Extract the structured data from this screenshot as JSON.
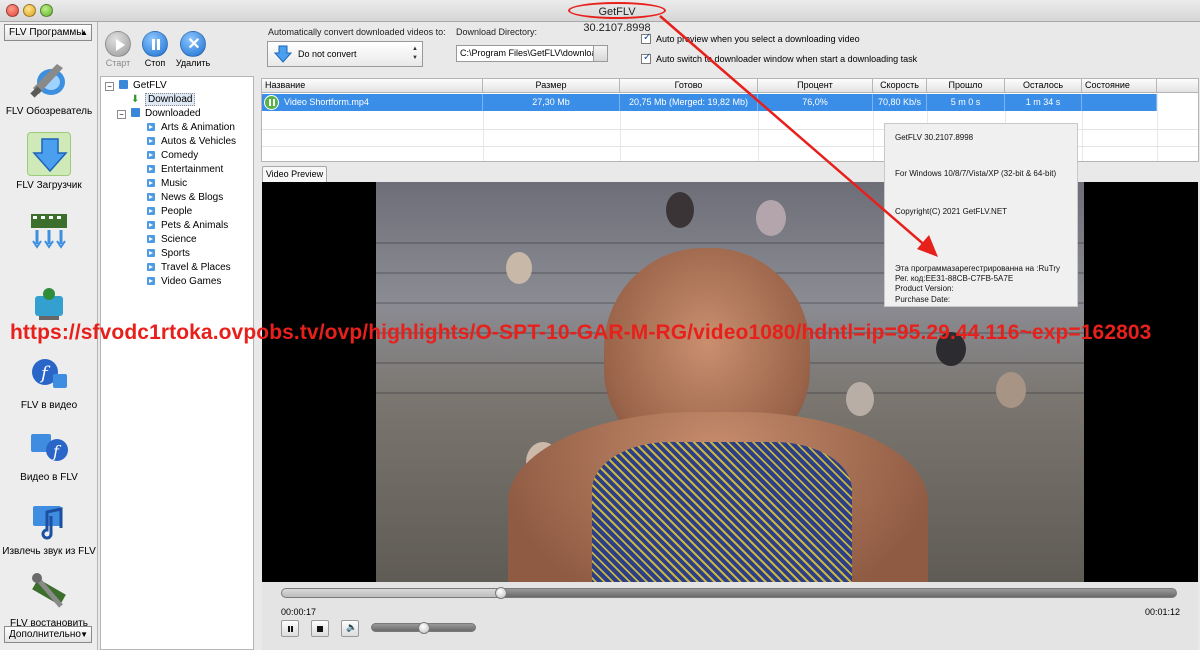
{
  "window": {
    "title": "GetFLV 30.2107.8998"
  },
  "sidebar": {
    "top_dropdown": "FLV Программы",
    "bottom_dropdown": "Дополнительно",
    "items": [
      {
        "label": "FLV Обозреватель",
        "icon": "browser-icon"
      },
      {
        "label": "FLV Загрузчик",
        "icon": "downloader-icon",
        "active": true
      },
      {
        "label": "",
        "icon": "film-convert-icon"
      },
      {
        "label": "",
        "icon": "video-download-icon"
      },
      {
        "label": "FLV в видео",
        "icon": "flv-to-video-icon"
      },
      {
        "label": "Видео в FLV",
        "icon": "video-to-flv-icon"
      },
      {
        "label": "Извлечь звук из FLV",
        "icon": "extract-audio-icon"
      },
      {
        "label": "FLV востановить",
        "icon": "repair-icon"
      }
    ]
  },
  "toolbar": {
    "start_label": "Старт",
    "stop_label": "Стоп",
    "delete_label": "Удалить",
    "convert_label": "Automatically convert downloaded videos to:",
    "convert_value": "Do not convert",
    "dir_label": "Download Directory:",
    "dir_value": "C:\\Program Files\\GetFLV\\download",
    "auto_preview_label": "Auto preview when you select a downloading video",
    "auto_switch_label": "Auto switch to downloader window when start a downloading task"
  },
  "tree": {
    "root": "GetFLV",
    "download": "Download",
    "downloaded": "Downloaded",
    "categories": [
      "Arts & Animation",
      "Autos & Vehicles",
      "Comedy",
      "Entertainment",
      "Music",
      "News & Blogs",
      "People",
      "Pets & Animals",
      "Science",
      "Sports",
      "Travel & Places",
      "Video Games"
    ]
  },
  "table": {
    "columns": [
      "Название",
      "Размер",
      "Готово",
      "Процент",
      "Скорость",
      "Прошло",
      "Осталось",
      "Состояние"
    ],
    "rows": [
      {
        "name": "Video Shortform.mp4",
        "size": "27,30 Mb",
        "done": "20,75 Mb  (Merged: 19,82 Mb)",
        "percent": "76,0%",
        "speed": "70,80 Kb/s",
        "elapsed": "5 m 0 s",
        "remaining": "1 m 34 s",
        "state": ""
      }
    ]
  },
  "preview": {
    "tab_label": "Video Preview",
    "time_current": "00:00:17",
    "time_total": "00:01:12",
    "seek_fraction": 0.245,
    "volume_fraction": 0.5
  },
  "about": {
    "line1": "GetFLV   30.2107.8998",
    "line2": "For Windows 10/8/7/Vista/XP (32-bit & 64-bit)",
    "line3": "Copyright(C) 2021 GetFLV.NET",
    "line4": "Эта программазарегестрированна на :RuTry",
    "line5": "Рег. код:EE31-88CB-C7FB-5A7E",
    "line6": "Product Version:",
    "line7": "Purchase Date:"
  },
  "overlay": {
    "url": "https://sfvodc1rtoka.ovpobs.tv/ovp/highlights/O-SPT-10-GAR-M-RG/video1080/hdntl=ip=95.29.44.116~exp=162803",
    "annotation_color": "#e8201c"
  }
}
